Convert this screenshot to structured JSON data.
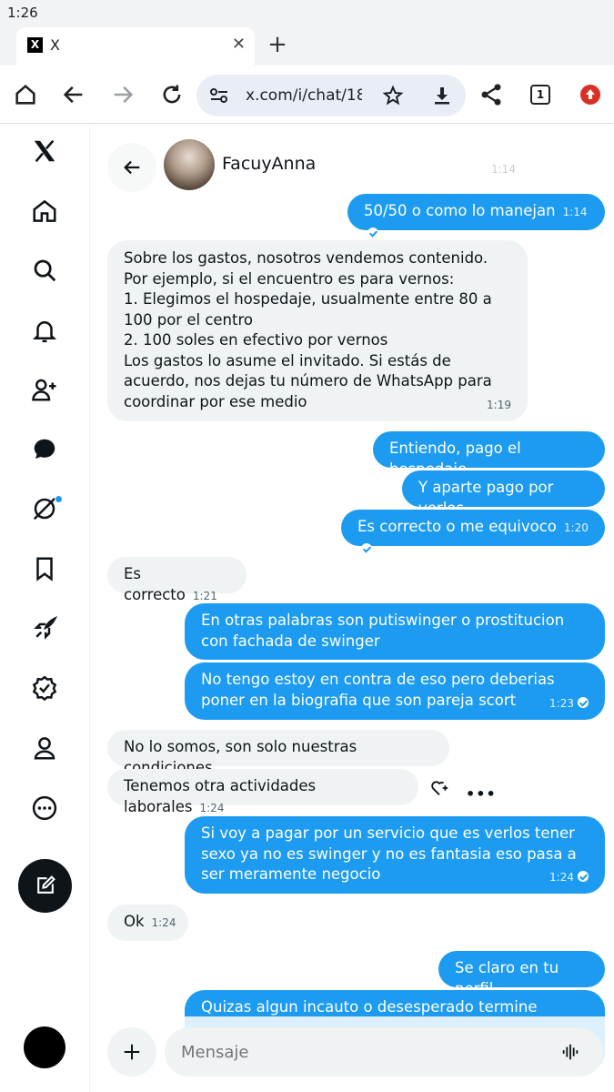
{
  "status_bar": {
    "time": "1:26"
  },
  "tab": {
    "title": "X",
    "favicon": "X"
  },
  "toolbar": {
    "url": "x.com/i/chat/18",
    "tab_count": "1"
  },
  "sidebar": {
    "items": [
      {
        "name": "x-logo-icon"
      },
      {
        "name": "home-icon"
      },
      {
        "name": "search-icon"
      },
      {
        "name": "notifications-icon"
      },
      {
        "name": "follow-icon"
      },
      {
        "name": "messages-icon"
      },
      {
        "name": "grok-icon"
      },
      {
        "name": "bookmark-icon"
      },
      {
        "name": "rocket-icon"
      },
      {
        "name": "verified-icon"
      },
      {
        "name": "profile-icon"
      },
      {
        "name": "more-icon"
      }
    ]
  },
  "chat": {
    "peer_name": "FacuyAnna",
    "faded_time": "1:14",
    "messages": [
      {
        "dir": "out",
        "text": "50/50 o como lo manejan",
        "time": "1:14"
      },
      {
        "dir": "in",
        "text": "Sobre los gastos, nosotros vendemos contenido. Por ejemplo, si el encuentro es para vernos:\n1. Elegimos el hospedaje, usualmente entre 80 a 100 por el centro\n2. 100 soles en efectivo por vernos\nLos gastos lo asume el invitado. Si estás de acuerdo, nos dejas tu número de WhatsApp para coordinar por ese medio",
        "time": "1:19"
      },
      {
        "dir": "out",
        "text": "Entiendo, pago el hospedaje",
        "time": ""
      },
      {
        "dir": "out",
        "text": "Y aparte pago por verlos",
        "time": ""
      },
      {
        "dir": "out",
        "text": "Es correcto o me equivoco",
        "time": "1:20"
      },
      {
        "dir": "in",
        "text": "Es correcto",
        "time": "1:21"
      },
      {
        "dir": "out",
        "text": "En otras palabras son putiswinger o prostitucion con fachada de swinger",
        "time": ""
      },
      {
        "dir": "out",
        "text": "No tengo estoy en contra de eso pero deberias poner en la biografia que son pareja scort",
        "time": "1:23"
      },
      {
        "dir": "in",
        "text": "No lo somos, son solo nuestras condiciones",
        "time": ""
      },
      {
        "dir": "in",
        "text": "Tenemos otra actividades laborales",
        "time": "1:24"
      },
      {
        "dir": "out",
        "text": "Si voy a pagar por un servicio que es verlos tener sexo ya no es swinger y no es fantasia eso pasa a ser meramente negocio",
        "time": "1:24"
      },
      {
        "dir": "in",
        "text": "Ok",
        "time": "1:24"
      },
      {
        "dir": "out",
        "text": "Se claro en tu perfil",
        "time": ""
      },
      {
        "dir": "out",
        "text": "Quizas algun incauto o desesperado termine",
        "time": ""
      }
    ]
  },
  "composer": {
    "placeholder": "Mensaje"
  }
}
